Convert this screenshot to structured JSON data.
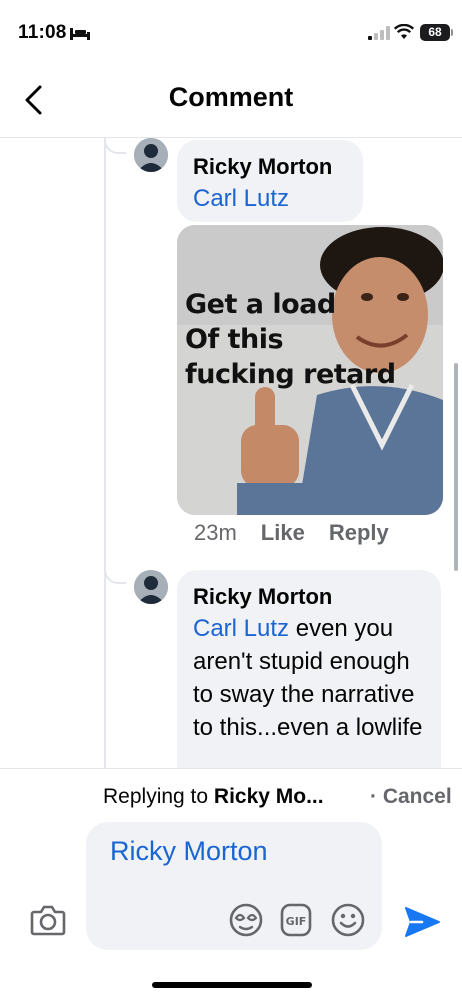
{
  "status_bar": {
    "time": "11:08",
    "battery": "68"
  },
  "header": {
    "title": "Comment"
  },
  "comments": [
    {
      "author": "Ricky Morton",
      "mention": "Carl Lutz",
      "text": ""
    },
    {
      "author": "Ricky Morton",
      "mention": "Carl Lutz",
      "text": " even you aren't stupid enough to sway the narrative to this...even a lowlife"
    }
  ],
  "meme": {
    "caption_line1": "Get a load",
    "caption_line2": "Of this",
    "caption_line3": "fucking retard"
  },
  "actions": {
    "time": "23m",
    "like": "Like",
    "reply": "Reply"
  },
  "reply_banner": {
    "prefix": "Replying to ",
    "name": "Ricky Mo...",
    "cancel": "· Cancel"
  },
  "composer": {
    "mention": "Ricky Morton"
  },
  "icons": {
    "back": "chevron-left-icon",
    "camera": "camera-icon",
    "sticker": "sticker-icon",
    "gif": "gif-icon",
    "emoji": "emoji-icon",
    "send": "send-icon"
  },
  "colors": {
    "accent": "#1a64d4",
    "bubble": "#f0f2f5",
    "secondary_text": "#65676b"
  }
}
